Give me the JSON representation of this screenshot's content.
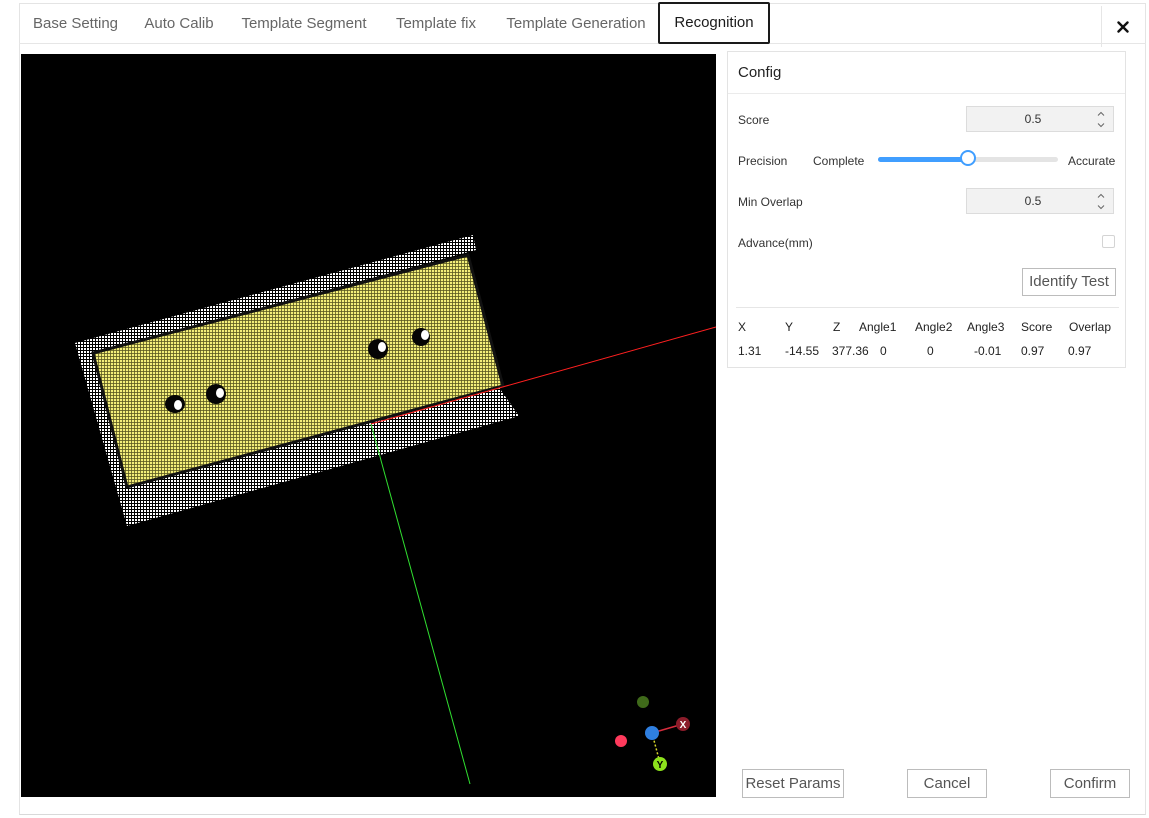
{
  "tabs": [
    "Base Setting",
    "Auto Calib",
    "Template Segment",
    "Template fix",
    "Template Generation",
    "Recognition"
  ],
  "active_tab": "Recognition",
  "close_icon": "close-icon",
  "config": {
    "title": "Config",
    "score_label": "Score",
    "score_value": "0.5",
    "precision_label": "Precision",
    "precision_min_label": "Complete",
    "precision_max_label": "Accurate",
    "precision_level": 0.5,
    "min_overlap_label": "Min Overlap",
    "min_overlap_value": "0.5",
    "advance_label": "Advance(mm)",
    "advance_checked": false,
    "identify_test_label": "Identify Test"
  },
  "result": {
    "headers": [
      "X",
      "Y",
      "Z",
      "Angle1",
      "Angle2",
      "Angle3",
      "Score",
      "Overlap"
    ],
    "values": [
      "1.31",
      "-14.55",
      "377.36",
      "0",
      "0",
      "-0.01",
      "0.97",
      "0.97"
    ]
  },
  "axes_gizmo": {
    "x_label": "X",
    "y_label": "Y"
  },
  "footer": {
    "reset_label": "Reset Params",
    "cancel_label": "Cancel",
    "confirm_label": "Confirm"
  },
  "colors": {
    "accent": "#409eff",
    "point_cloud_yellow": "#f4ef7a",
    "axis_x": "#ff2020",
    "axis_y": "#30e030"
  }
}
